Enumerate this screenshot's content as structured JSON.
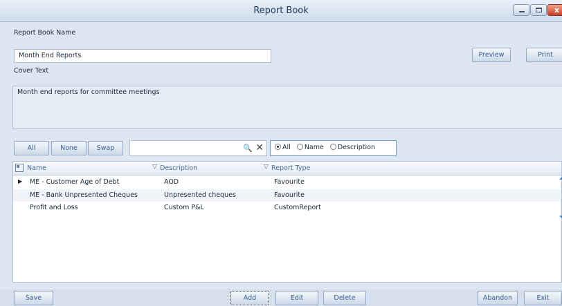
{
  "window": {
    "title": "Report Book",
    "min_label": "",
    "max_label": "",
    "close_label": "x"
  },
  "form": {
    "name_label": "Report Book Name",
    "name_value": "Month End Reports",
    "cover_label": "Cover Text",
    "cover_value": "Month end reports for committee meetings"
  },
  "actions_top": {
    "preview": "Preview",
    "print": "Print"
  },
  "selection": {
    "all": "All",
    "none": "None",
    "swap": "Swap"
  },
  "search": {
    "value": "",
    "search_glyph": "🔍",
    "clear_glyph": "✕"
  },
  "filter": {
    "options": [
      "All",
      "Name",
      "Description"
    ],
    "selected": "All"
  },
  "grid": {
    "columns": [
      "Name",
      "Description",
      "Report Type"
    ],
    "rows": [
      {
        "name": "ME - Customer Age of Debt",
        "description": "AOD",
        "type": "Favourite",
        "current": true
      },
      {
        "name": "ME - Bank Unpresented Cheques",
        "description": "Unpresented cheques",
        "type": "Favourite",
        "current": false
      },
      {
        "name": "Profit and Loss",
        "description": "Custom P&L",
        "type": "CustomReport",
        "current": false
      }
    ]
  },
  "move": {
    "up_glyph": "⇧",
    "down_glyph": "⇩"
  },
  "footer": {
    "save": "Save",
    "add": "Add",
    "edit": "Edit",
    "delete": "Delete",
    "abandon": "Abandon",
    "exit": "Exit"
  }
}
